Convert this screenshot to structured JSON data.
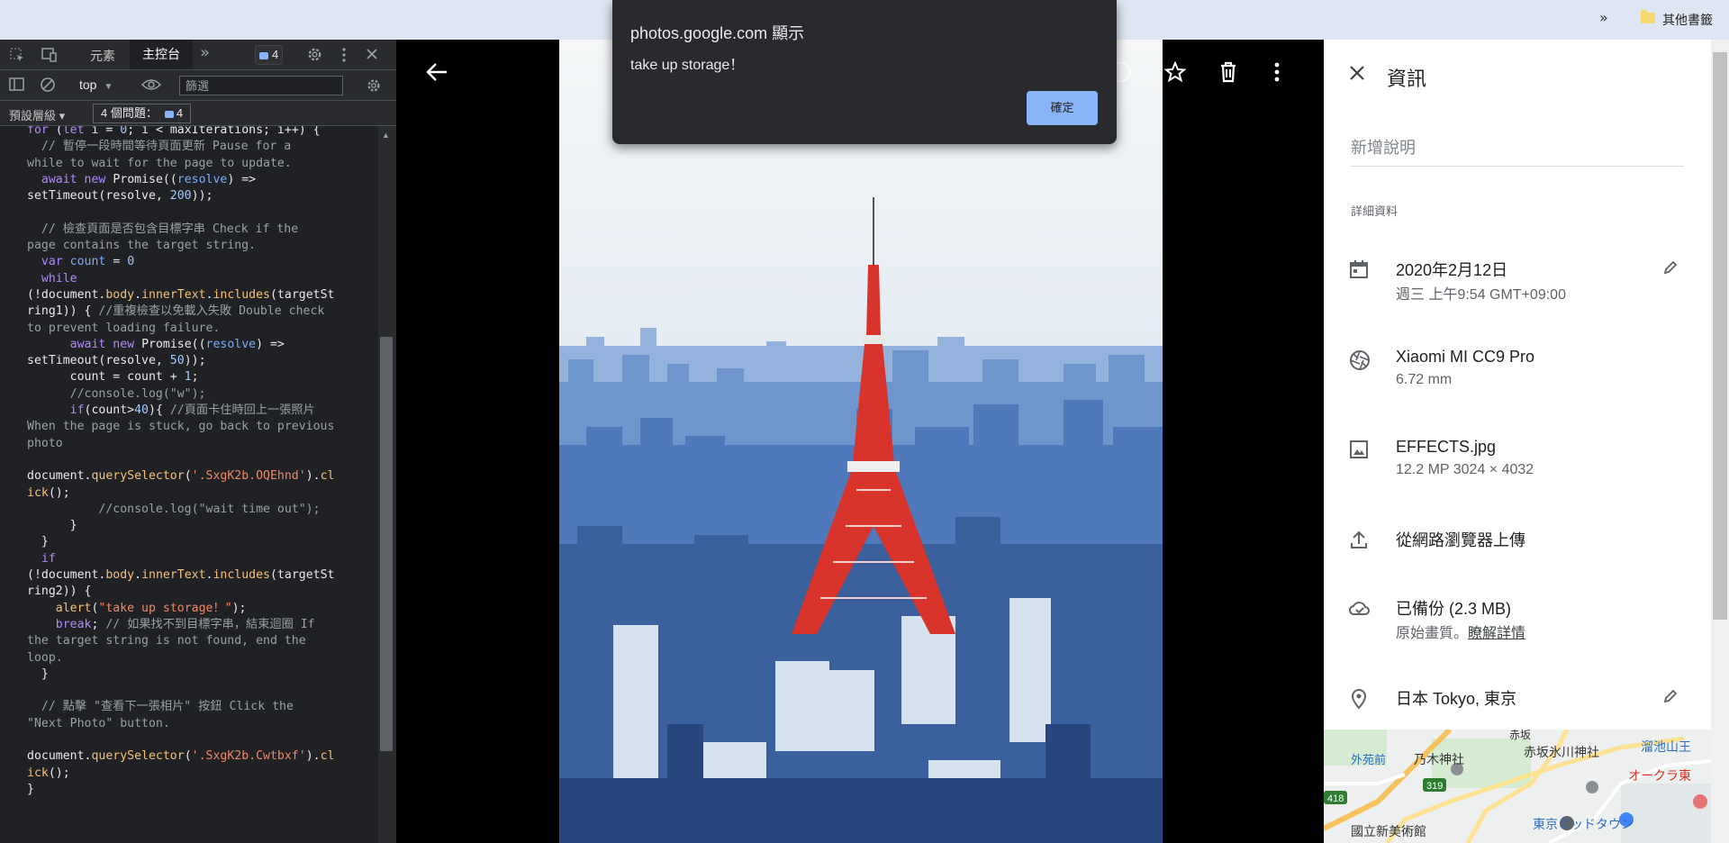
{
  "bookmarks_bar": {
    "overflow_icon": "»",
    "folder_label": "其他書籤"
  },
  "devtools": {
    "tabs": {
      "elements": "元素",
      "console": "主控台"
    },
    "issues_badge_count": "4",
    "context": "top",
    "filter_placeholder": "篩選",
    "levels_label": "預設層級 ▾",
    "issues_text": "4 個問題：",
    "issues_count": "4",
    "console_prompt": "›"
  },
  "alert": {
    "title": "photos.google.com 顯示",
    "message": "take up storage！",
    "ok_label": "確定"
  },
  "info_panel": {
    "title": "資訊",
    "description_placeholder": "新增說明",
    "details_heading": "詳細資料",
    "date": {
      "main": "2020年2月12日",
      "sub": "週三 上午9:54   GMT+09:00"
    },
    "camera": {
      "main": "Xiaomi MI CC9 Pro",
      "sub": "6.72 mm"
    },
    "file": {
      "main": "EFFECTS.jpg",
      "sub": "12.2 MP   3024 × 4032"
    },
    "upload": {
      "main": "從網路瀏覽器上傳"
    },
    "backup": {
      "main": "已備份 (2.3 MB)",
      "sub_prefix": "原始畫質。",
      "sub_link": "瞭解詳情"
    },
    "location": {
      "main": "日本 Tokyo, 東京"
    },
    "map_labels": {
      "a": "赤坂",
      "b": "溜池山王",
      "c": "外苑前",
      "d": "乃木神社",
      "e": "赤坂氷川神社",
      "f": "オークラ東",
      "g": "國立新美術館",
      "h": "東京ミッドタウン",
      "r1": "418",
      "r2": "319"
    }
  },
  "colors": {
    "devtools_bg": "#202124",
    "accent_blue": "#8ab4f8",
    "tower_red": "#d8342c"
  }
}
